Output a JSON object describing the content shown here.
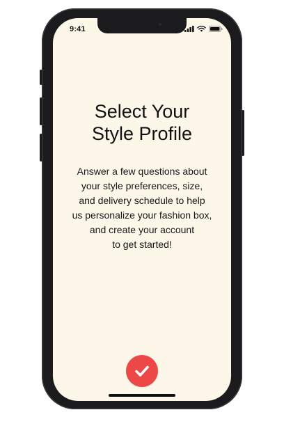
{
  "status_bar": {
    "time": "9:41",
    "icons": [
      "cellular-signal-icon",
      "wifi-icon",
      "battery-icon"
    ]
  },
  "onboarding": {
    "title_lines": [
      "Select Your",
      "Style Profile"
    ],
    "description_lines": [
      "Answer a few questions about",
      "your style preferences, size,",
      "and delivery schedule to help",
      "us personalize your fashion box,",
      "and create your account",
      "to get started!"
    ],
    "confirm_icon": "checkmark-icon"
  },
  "colors": {
    "screen_background": "#fdf7ea",
    "accent": "#ec4848",
    "text": "#111111",
    "device_frame": "#1b1b1d"
  }
}
